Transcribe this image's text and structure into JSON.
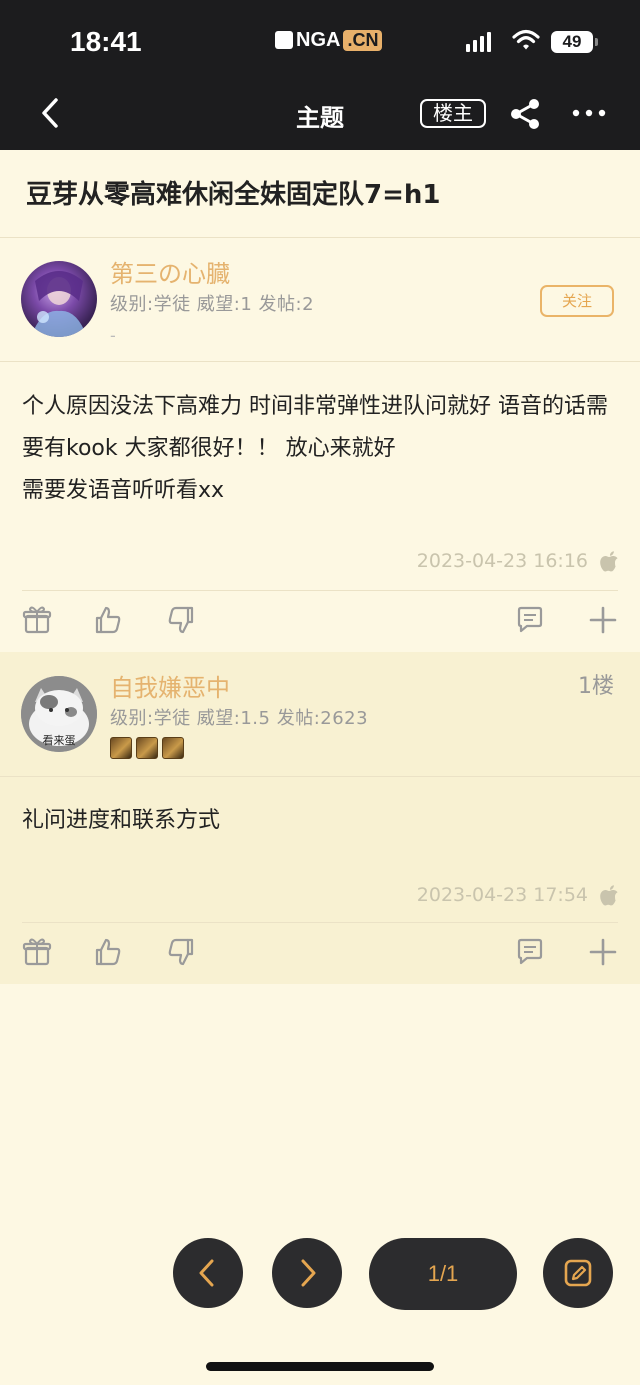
{
  "status_bar": {
    "time": "18:41",
    "brand_text": "NGA",
    "brand_suffix": ".CN",
    "battery": "49"
  },
  "nav": {
    "title": "主题",
    "op_label": "楼主",
    "icons": [
      "back-chevron-icon",
      "share-icon",
      "more-icon"
    ]
  },
  "thread": {
    "title": "豆芽从零高难休闲全妹固定队7=h1"
  },
  "posts": [
    {
      "username": "第三の心臓",
      "meta": "级别:学徒  威望:1  发帖:2",
      "signature": "-",
      "follow_label": "关注",
      "content": "个人原因没法下高难力 时间非常弹性进队问就好 语音的话需要有kook 大家都很好！！ 放心来就好\n需要发语音听听看xx",
      "timestamp": "2023-04-23 16:16"
    },
    {
      "username": "自我嫌恶中",
      "floor": "1楼",
      "meta": "级别:学徒  威望:1.5  发帖:2623",
      "avatar_text": "看来蛋",
      "content": "礼问进度和联系方式",
      "timestamp": "2023-04-23 17:54"
    }
  ],
  "pagination": {
    "page": "1/1"
  },
  "colors": {
    "background": "#fdf8e3",
    "header": "#1c1c1e",
    "accent": "#e5b36f",
    "alt_post": "#f8f1d2"
  }
}
